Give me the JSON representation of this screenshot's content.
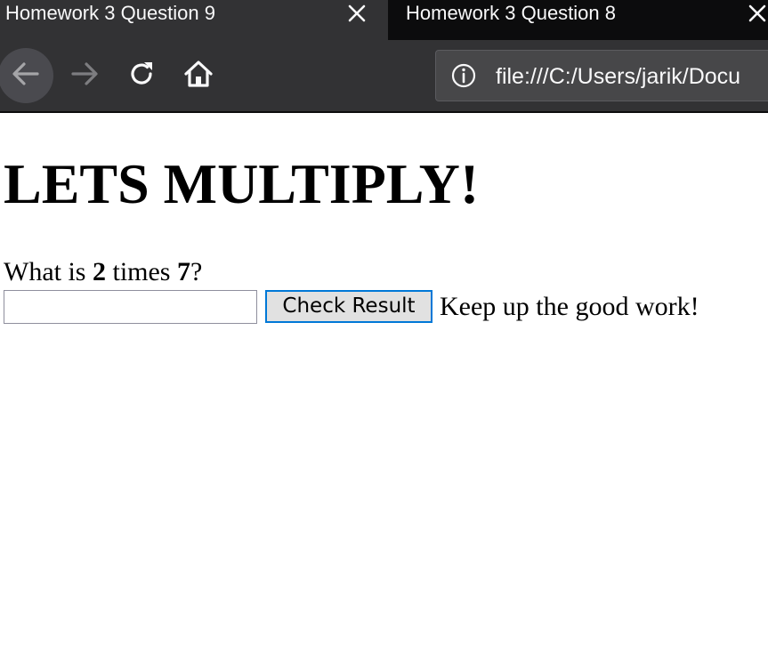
{
  "browser": {
    "tabs": [
      {
        "title": "Homework 3 Question 9",
        "active": true
      },
      {
        "title": "Homework 3 Question 8",
        "active": false
      }
    ],
    "url": "file:///C:/Users/jarik/Docu",
    "icons": {
      "close": "close-icon",
      "back": "back-arrow-icon",
      "forward": "forward-arrow-icon",
      "reload": "reload-icon",
      "home": "home-icon",
      "info": "info-icon"
    },
    "colors": {
      "tabstrip": "#0c0c0d",
      "toolbar": "#323234",
      "urlbar": "#474749",
      "text": "#f9f9fa"
    }
  },
  "page": {
    "heading": "LETS MULTIPLY!",
    "question": {
      "prefix": "What is ",
      "a": "2",
      "middle": " times ",
      "b": "7",
      "suffix": "?"
    },
    "answer": {
      "value": "",
      "placeholder": ""
    },
    "check_button_label": "Check Result",
    "feedback": "Keep up the good work!",
    "colors": {
      "button_focus_border": "#0078d7",
      "button_bg": "#e1e1e1"
    }
  }
}
